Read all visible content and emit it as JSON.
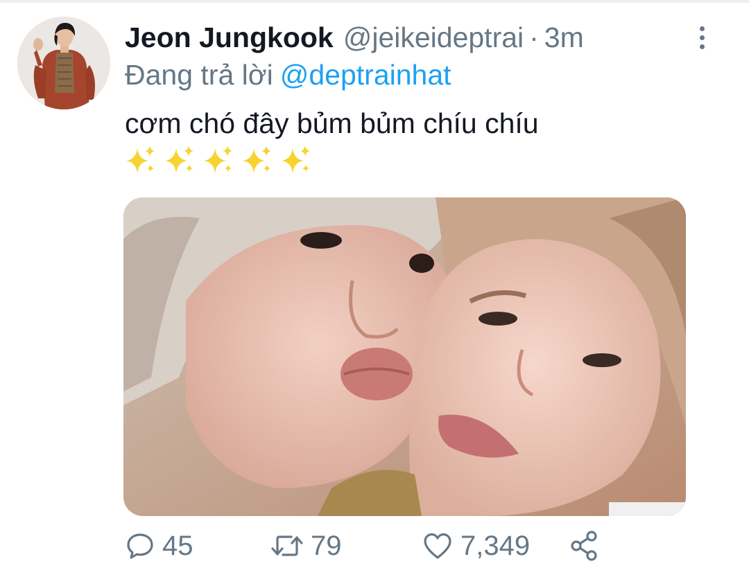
{
  "tweet": {
    "display_name": "Jeon Jungkook",
    "handle": "@jeikeideptrai",
    "separator": "·",
    "time": "3m",
    "reply_prefix": "Đang trả lời",
    "reply_to": "@deptrainhat",
    "text": "cơm chó đây bủm bủm chíu chíu",
    "emoji": "✨✨✨✨✨",
    "colors": {
      "text": "#141823",
      "secondary": "#657786",
      "accent": "#1da1f2",
      "sparkle": "#f7d330"
    }
  },
  "actions": {
    "reply": {
      "icon": "reply-icon",
      "count": "45"
    },
    "retweet": {
      "icon": "retweet-icon",
      "count": "79"
    },
    "like": {
      "icon": "heart-icon",
      "count": "7,349"
    },
    "share": {
      "icon": "share-icon"
    }
  },
  "more_icon": "more-vertical-icon",
  "media": {
    "kind": "photo"
  }
}
